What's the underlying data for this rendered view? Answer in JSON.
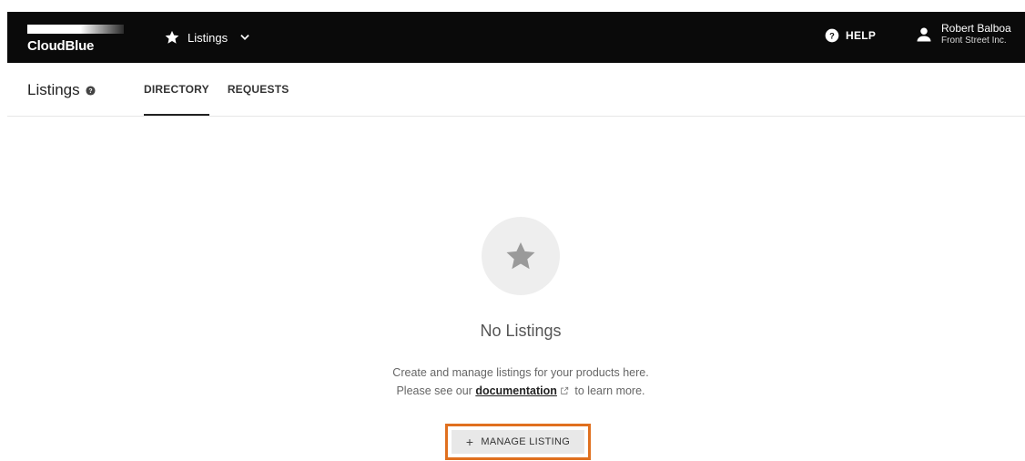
{
  "topbar": {
    "brand": "CloudBlue",
    "module": {
      "label": "Listings",
      "icon": "star-icon",
      "dropdown_icon": "chevron-down-icon"
    },
    "help_label": "HELP",
    "user": {
      "name": "Robert Balboa",
      "organization": "Front Street Inc."
    }
  },
  "subheader": {
    "title": "Listings",
    "tabs": [
      {
        "label": "DIRECTORY",
        "active": true
      },
      {
        "label": "REQUESTS",
        "active": false
      }
    ]
  },
  "empty_state": {
    "title": "No Listings",
    "line1": "Create and manage listings for your products here.",
    "line2_prefix": "Please see our",
    "link_text": "documentation",
    "line2_suffix": "to learn more.",
    "button_label": "MANAGE LISTING",
    "button_icon": "+"
  },
  "colors": {
    "topbar_bg": "#0a0a0a",
    "highlight_border": "#e0701f",
    "button_bg": "#e8e8e8"
  }
}
